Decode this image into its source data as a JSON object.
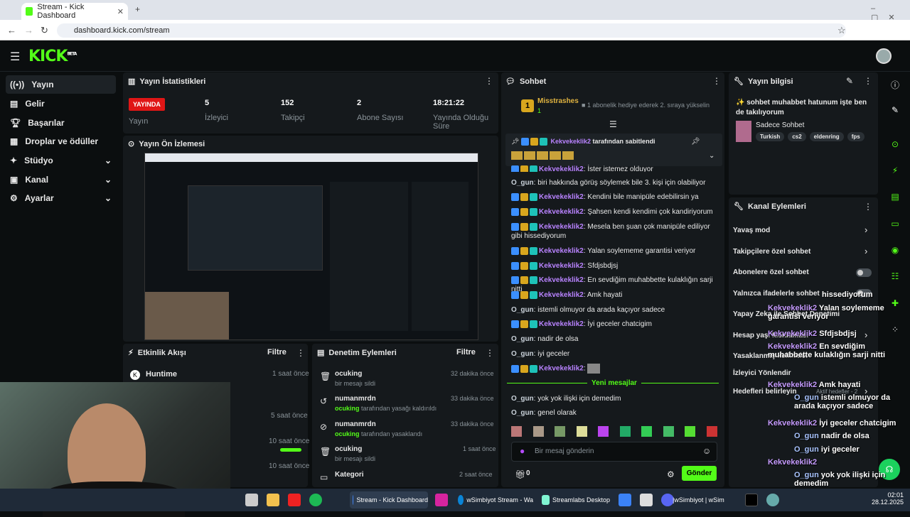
{
  "browser": {
    "tab_title": "Stream - Kick Dashboard",
    "url": "dashboard.kick.com/stream"
  },
  "app": {
    "logo": "KICK",
    "logo_sup": "BETA"
  },
  "sidebar": {
    "items": [
      {
        "label": "Yayın",
        "icon": "broadcast-icon",
        "active": true
      },
      {
        "label": "Gelir",
        "icon": "wallet-icon"
      },
      {
        "label": "Başarılar",
        "icon": "trophy-icon"
      },
      {
        "label": "Droplar ve ödüller",
        "icon": "gift-icon"
      },
      {
        "label": "Stüdyo",
        "icon": "studio-icon",
        "expandable": true
      },
      {
        "label": "Kanal",
        "icon": "channel-icon",
        "expandable": true
      },
      {
        "label": "Ayarlar",
        "icon": "gear-icon",
        "expandable": true
      }
    ]
  },
  "stats": {
    "title": "Yayın İstatistikleri",
    "live_badge": "YAYINDA",
    "items": [
      {
        "value": "",
        "label": "Yayın"
      },
      {
        "value": "5",
        "label": "İzleyici"
      },
      {
        "value": "152",
        "label": "Takipçi"
      },
      {
        "value": "2",
        "label": "Abone Sayısı"
      },
      {
        "value": "18:21:22",
        "label": "Yayında Olduğu Süre"
      }
    ]
  },
  "preview": {
    "title": "Yayın Ön İzlemesi"
  },
  "activity": {
    "title": "Etkinlik Akışı",
    "filter": "Filtre",
    "items": [
      {
        "name": "Huntime",
        "time": "1 saat önce"
      },
      {
        "name": "",
        "time": "5 saat önce"
      },
      {
        "name": "",
        "time": "10 saat önce"
      },
      {
        "name": "",
        "time": "10 saat önce"
      }
    ]
  },
  "moderation": {
    "title": "Denetim Eylemleri",
    "filter": "Filtre",
    "items": [
      {
        "user": "ocuking",
        "detail": "bir mesajı sildi",
        "time": "32 dakika önce",
        "icon": "trash-icon"
      },
      {
        "user": "numanmrdn",
        "detail_user": "ocuking",
        "detail": "tarafından yasağı kaldırıldı",
        "time": "33 dakika önce",
        "icon": "undo-icon"
      },
      {
        "user": "numanmrdn",
        "detail_user": "ocuking",
        "detail": "tarafından yasaklandı",
        "time": "33 dakika önce",
        "icon": "ban-icon"
      },
      {
        "user": "ocuking",
        "detail": "bir mesajı sildi",
        "time": "1 saat önce",
        "icon": "trash-icon"
      },
      {
        "user": "Kategori",
        "detail": "",
        "time": "2 saat önce",
        "icon": "category-icon"
      }
    ]
  },
  "chat": {
    "title": "Sohbet",
    "top_gifter": "Misstrashes",
    "top_gifter_count": "1",
    "gift_notice": "1 abonelik hediye ederek 2. sıraya yükselin",
    "pinned_by": "Kekvekeklik2",
    "pinned_suffix": "tarafından sabitlendi",
    "messages": [
      {
        "user": "Kekvekeklik2",
        "text": "İster istemez olduyor",
        "badges": true
      },
      {
        "user": "O_gun",
        "text": "biri hakkında görüş söylemek bile 3. kişi için olabiliyor",
        "badges": false
      },
      {
        "user": "Kekvekeklik2",
        "text": "Kendini bile manipüle edebilirsin ya",
        "badges": true
      },
      {
        "user": "Kekvekeklik2",
        "text": "Şahsen kendi kendimi çok kandiriyorum",
        "badges": true
      },
      {
        "user": "Kekvekeklik2",
        "text": "Mesela ben şuan çok manipüle ediliyor gibi hissediyorum",
        "badges": true
      },
      {
        "user": "Kekvekeklik2",
        "text": "Yalan soylememe garantisi veriyor",
        "badges": true
      },
      {
        "user": "Kekvekeklik2",
        "text": "Sfdjsbdjsj",
        "badges": true
      },
      {
        "user": "Kekvekeklik2",
        "text": "En sevdiğim muhabbette kulaklığın sarji nitti",
        "badges": true
      },
      {
        "user": "Kekvekeklik2",
        "text": "Amk hayati",
        "badges": true
      },
      {
        "user": "O_gun",
        "text": "istemli olmuyor da arada kaçıyor sadece",
        "badges": false
      },
      {
        "user": "Kekvekeklik2",
        "text": "İyi geceler chatcigim",
        "badges": true
      },
      {
        "user": "O_gun",
        "text": "nadir de olsa",
        "badges": false
      },
      {
        "user": "O_gun",
        "text": "iyi geceler",
        "badges": false
      },
      {
        "user": "Kekvekeklik2",
        "text": "",
        "badges": true
      }
    ],
    "new_messages": "Yeni mesajlar",
    "after": [
      {
        "user": "O_gun",
        "text": "yok yok ilişki için demedim"
      },
      {
        "user": "O_gun",
        "text": "genel olarak"
      }
    ],
    "input_placeholder": "Bir mesaj gönderin",
    "points": "0",
    "send": "Gönder"
  },
  "stream_info": {
    "title": "Yayın bilgisi",
    "stream_title": "✨ sohbet muhabbet hatunum işte ben de takılıyorum",
    "category": "Sadece Sohbet",
    "tags": [
      "Turkish",
      "cs2",
      "eldenring",
      "fps"
    ]
  },
  "channel_actions": {
    "title": "Kanal Eylemleri",
    "items": [
      {
        "label": "Yavaş mod",
        "type": "arrow"
      },
      {
        "label": "Takipçilere özel sohbet",
        "type": "arrow"
      },
      {
        "label": "Abonelere özel sohbet",
        "type": "toggle"
      },
      {
        "label": "Yalnızca ifadelerle sohbet",
        "type": "toggle"
      },
      {
        "label": "Yapay Zeka ile Sohbet Denetimi",
        "type": "arrow"
      },
      {
        "label": "Hesap yaşı kısıtlaması",
        "type": "arrow"
      },
      {
        "label": "Yasaklanmış kelimeler",
        "type": "arrow"
      },
      {
        "label": "İzleyici Yönlendir",
        "type": "none"
      },
      {
        "label": "Hedefleri belirleyin",
        "type": "arrow",
        "sub": "Aktif hedefler - 2"
      }
    ]
  },
  "overlay_chat": [
    {
      "user": "",
      "text": "hissediyorum"
    },
    {
      "user": "Kekvekeklik2",
      "text": "Yalan soylememe garantisi veriyor"
    },
    {
      "user": "Kekvekeklik2",
      "text": "Sfdjsbdjsj"
    },
    {
      "user": "Kekvekeklik2",
      "text": "En sevdiğim muhabbette kulaklığın sarji nitti"
    },
    {
      "user": "Kekvekeklik2",
      "text": "Amk hayati"
    },
    {
      "user": "O_gun",
      "text": "istemli olmuyor da arada kaçıyor sadece"
    },
    {
      "user": "Kekvekeklik2",
      "text": "İyi geceler chatcigim"
    },
    {
      "user": "O_gun",
      "text": "nadir de olsa"
    },
    {
      "user": "O_gun",
      "text": "iyi geceler"
    },
    {
      "user": "Kekvekeklik2",
      "text": ""
    },
    {
      "user": "O_gun",
      "text": "yok yok ilişki için demedim"
    },
    {
      "user": "O_gun",
      "text": "genel olarak"
    }
  ],
  "taskbar": {
    "apps": [
      "Stream - Kick Dashboard",
      "wSimbiyot Stream - Wa",
      "Streamlabs Desktop",
      "|wSimbiyot | wSim"
    ],
    "time": "02:01",
    "date": "28.12.2025"
  }
}
